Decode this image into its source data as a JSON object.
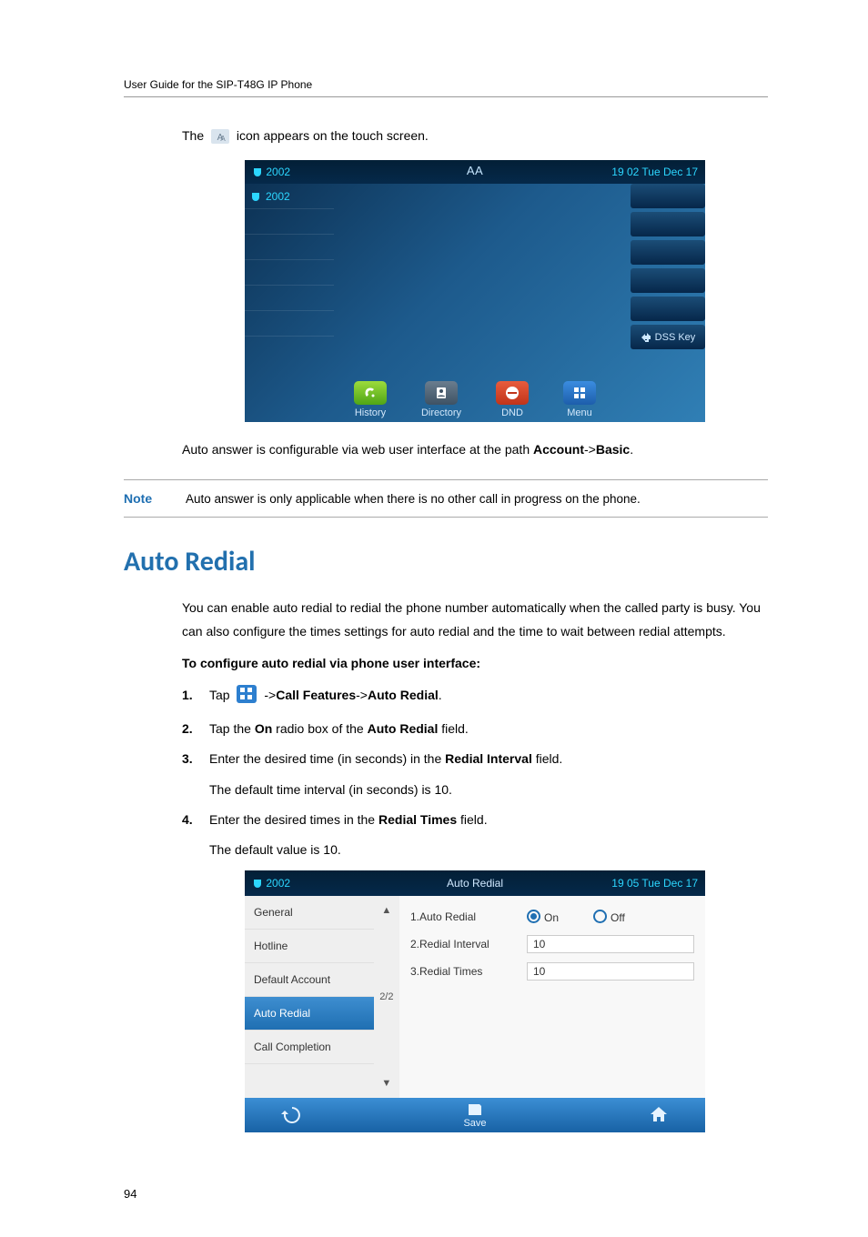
{
  "header": "User Guide for the SIP-T48G IP Phone",
  "intro_line": {
    "pre": "The ",
    "post": " icon appears on the touch screen."
  },
  "screenshot1": {
    "account": "2002",
    "time": "19 02 Tue Dec 17",
    "aa_icon_text": "AA",
    "line_label": "2002",
    "dss": "DSS Key",
    "softkeys": [
      "History",
      "Directory",
      "DND",
      "Menu"
    ]
  },
  "path_line": {
    "pre": "Auto answer is configurable via web user interface at the path ",
    "p1": "Account",
    "sep": "->",
    "p2": "Basic",
    "end": "."
  },
  "note": {
    "label": "Note",
    "text": "Auto answer is only applicable when there is no other call in progress on the phone."
  },
  "section_title": "Auto Redial",
  "section_body": "You can enable auto redial to redial the phone number automatically when the called party is busy. You can also configure the times settings for auto redial and the time to wait between redial attempts.",
  "config_heading": "To configure auto redial via phone user interface:",
  "steps": {
    "s1": {
      "num": "1.",
      "pre": "Tap ",
      "post": " ->",
      "p1": "Call Features",
      "sep": "->",
      "p2": "Auto Redial",
      "end": "."
    },
    "s2": {
      "num": "2.",
      "pre": "Tap the ",
      "b1": "On",
      "mid": " radio box of the ",
      "b2": "Auto Redial",
      "post": " field."
    },
    "s3": {
      "num": "3.",
      "pre": "Enter the desired time (in seconds) in the ",
      "b1": "Redial Interval",
      "post": " field."
    },
    "s3_sub": "The default time interval (in seconds) is 10.",
    "s4": {
      "num": "4.",
      "pre": "Enter the desired times in the ",
      "b1": "Redial Times",
      "post": " field."
    },
    "s4_sub": "The default value is 10."
  },
  "screenshot2": {
    "account": "2002",
    "title": "Auto Redial",
    "time": "19 05 Tue Dec 17",
    "menu": [
      "General",
      "Hotline",
      "Default Account",
      "Auto Redial",
      "Call Completion"
    ],
    "selected_index": 3,
    "scroll_page": "2/2",
    "rows": {
      "r1_label": "1.Auto Redial",
      "r1_on": "On",
      "r1_off": "Off",
      "r2_label": "2.Redial Interval",
      "r2_value": "10",
      "r3_label": "3.Redial Times",
      "r3_value": "10"
    },
    "save": "Save"
  },
  "page_number": "94",
  "chart_data": {
    "type": "table",
    "title": "Auto Redial settings",
    "rows": [
      {
        "field": "Auto Redial",
        "value": "On"
      },
      {
        "field": "Redial Interval",
        "value": 10
      },
      {
        "field": "Redial Times",
        "value": 10
      }
    ]
  }
}
